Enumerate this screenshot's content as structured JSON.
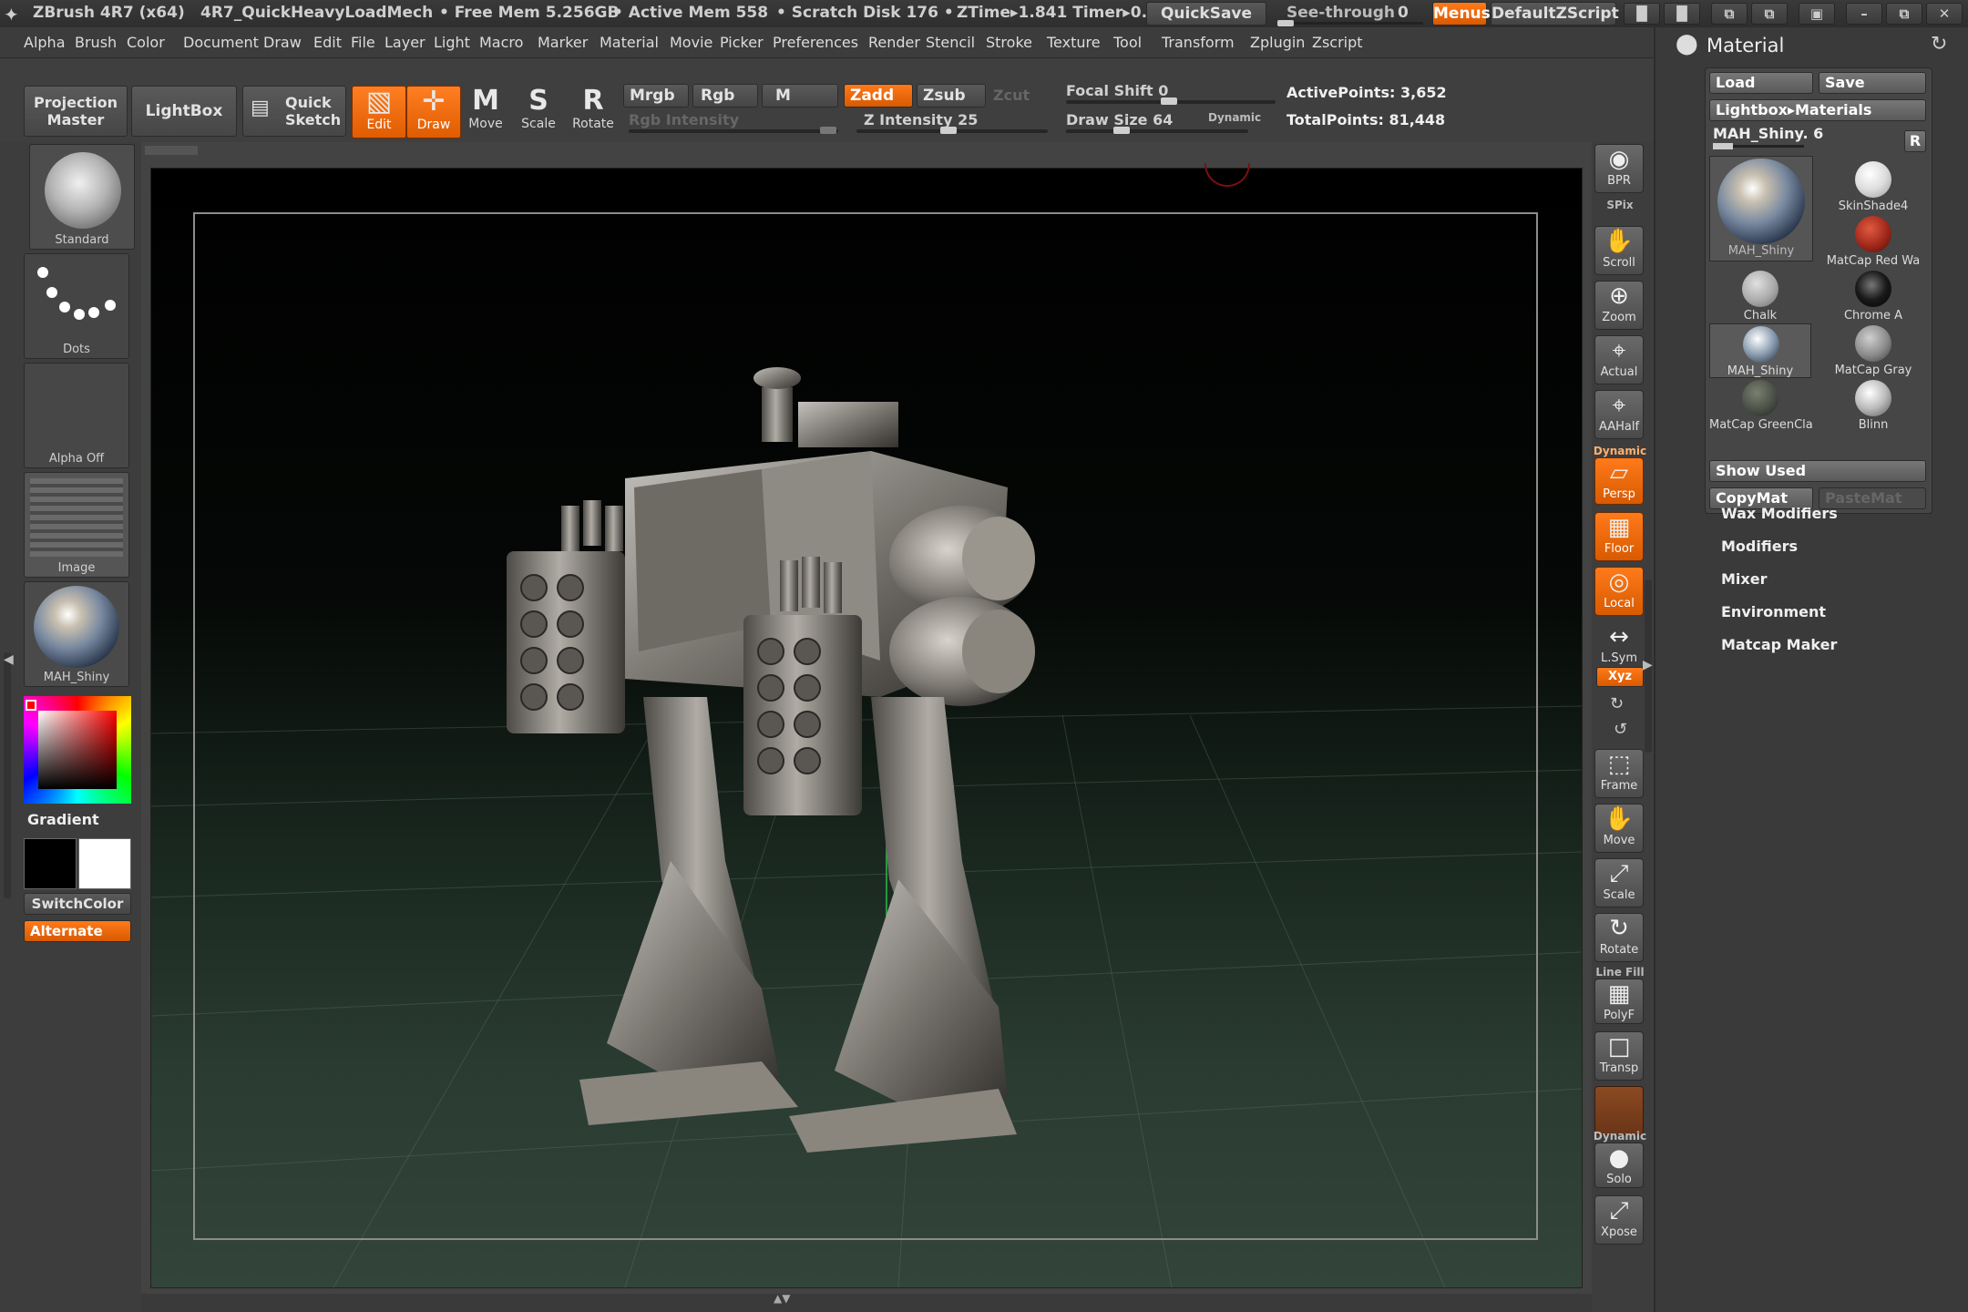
{
  "titlebar": {
    "app": "ZBrush 4R7 (x64)",
    "project": "4R7_QuickHeavyLoadMech",
    "free_mem": "• Free Mem 5.256GB",
    "active_mem": "• Active Mem 558",
    "scratch": "• Scratch Disk 176 •",
    "ztime": "ZTime▸1.841 Timer▸0.",
    "quicksave": "QuickSave",
    "see_through": "See-through",
    "see_through_val": "0",
    "menus": "Menus",
    "script": "DefaultZScript"
  },
  "menus": [
    "Alpha",
    "Brush",
    "Color",
    "Document",
    "Draw",
    "Edit",
    "File",
    "Layer",
    "Light",
    "Macro",
    "Marker",
    "Material",
    "Movie",
    "Picker",
    "Preferences",
    "Render",
    "Stencil",
    "Stroke",
    "Texture",
    "Tool",
    "Transform",
    "Zplugin",
    "Zscript"
  ],
  "toolbar": {
    "projection_master": "Projection Master",
    "lightbox": "LightBox",
    "quick_sketch": "Quick Sketch",
    "tools": [
      {
        "label": "Edit",
        "glyph": "▧",
        "selected": true
      },
      {
        "label": "Draw",
        "glyph": "✛",
        "selected": true
      },
      {
        "label": "Move",
        "glyph": "M",
        "selected": false
      },
      {
        "label": "Scale",
        "glyph": "S",
        "selected": false
      },
      {
        "label": "Rotate",
        "glyph": "R",
        "selected": false
      }
    ],
    "mrgb": "Mrgb",
    "rgb": "Rgb",
    "m": "M",
    "zadd": "Zadd",
    "zsub": "Zsub",
    "zcut": "Zcut",
    "rgb_intensity": "Rgb Intensity",
    "z_intensity": "Z Intensity 25",
    "focal_shift": "Focal Shift 0",
    "draw_size": "Draw Size 64",
    "dynamic": "Dynamic",
    "active_points": "ActivePoints: 3,652",
    "total_points": "TotalPoints: 81,448"
  },
  "left": {
    "brush": "Standard",
    "stroke": "Dots",
    "alpha": "Alpha Off",
    "texture": "Image",
    "material": "MAH_Shiny",
    "gradient": "Gradient",
    "switchcolor": "SwitchColor",
    "alternate": "Alternate"
  },
  "shelf": [
    {
      "label": "BPR",
      "glyph": "◉",
      "orange": false
    },
    {
      "label": "Scroll",
      "glyph": "✋",
      "orange": false
    },
    {
      "label": "Zoom",
      "glyph": "⊕",
      "orange": false
    },
    {
      "label": "Actual",
      "glyph": "⌖",
      "orange": false
    },
    {
      "label": "AAHalf",
      "glyph": "⌖",
      "orange": false
    },
    {
      "label": "Persp",
      "glyph": "▱",
      "orange": true
    },
    {
      "label": "Floor",
      "glyph": "▦",
      "orange": true
    },
    {
      "label": "Local",
      "glyph": "◎",
      "orange": true
    },
    {
      "label": "L.Sym",
      "glyph": "↔",
      "orange": false
    },
    {
      "label": "Frame",
      "glyph": "⬚",
      "orange": false
    },
    {
      "label": "Move",
      "glyph": "✋",
      "orange": false
    },
    {
      "label": "Scale",
      "glyph": "⤢",
      "orange": false
    },
    {
      "label": "Rotate",
      "glyph": "↻",
      "orange": false
    },
    {
      "label": "PolyF",
      "glyph": "▦",
      "orange": false
    },
    {
      "label": "Transp",
      "glyph": "□",
      "orange": false
    },
    {
      "label": "Solo",
      "glyph": "●",
      "orange": false
    },
    {
      "label": "Xpose",
      "glyph": "⤢",
      "orange": false
    }
  ],
  "shelf_extra": {
    "spix": "SPix",
    "dynamic": "Dynamic",
    "xyz": "Xyz",
    "line_fill": "Line Fill",
    "dynamic2": "Dynamic"
  },
  "material_panel": {
    "title": "Material",
    "load": "Load",
    "save": "Save",
    "lightbox_materials": "Lightbox▸Materials",
    "current": "MAH_Shiny. 6",
    "r": "R",
    "swatches": [
      {
        "name": "SkinShade4",
        "color": "#e8e8e8"
      },
      {
        "name": "MatCap Red Wa",
        "color": "#a0281a"
      },
      {
        "name": "Chalk",
        "color": "#bcbcbc"
      },
      {
        "name": "Chrome A",
        "color": "#1a1a1a"
      },
      {
        "name": "MAH_Shiny",
        "color": "#8a9cb0"
      },
      {
        "name": "MatCap Gray",
        "color": "#9a9a9a"
      },
      {
        "name": "MatCap GreenCla",
        "color": "#4a5046"
      },
      {
        "name": "Blinn",
        "color": "#d8d8d8"
      }
    ],
    "big_swatch": "MAH_Shiny",
    "show_used": "Show Used",
    "copymat": "CopyMat",
    "pastemat": "PasteMat",
    "subpalettes": [
      "Wax Modifiers",
      "Modifiers",
      "Mixer",
      "Environment",
      "Matcap Maker"
    ]
  }
}
